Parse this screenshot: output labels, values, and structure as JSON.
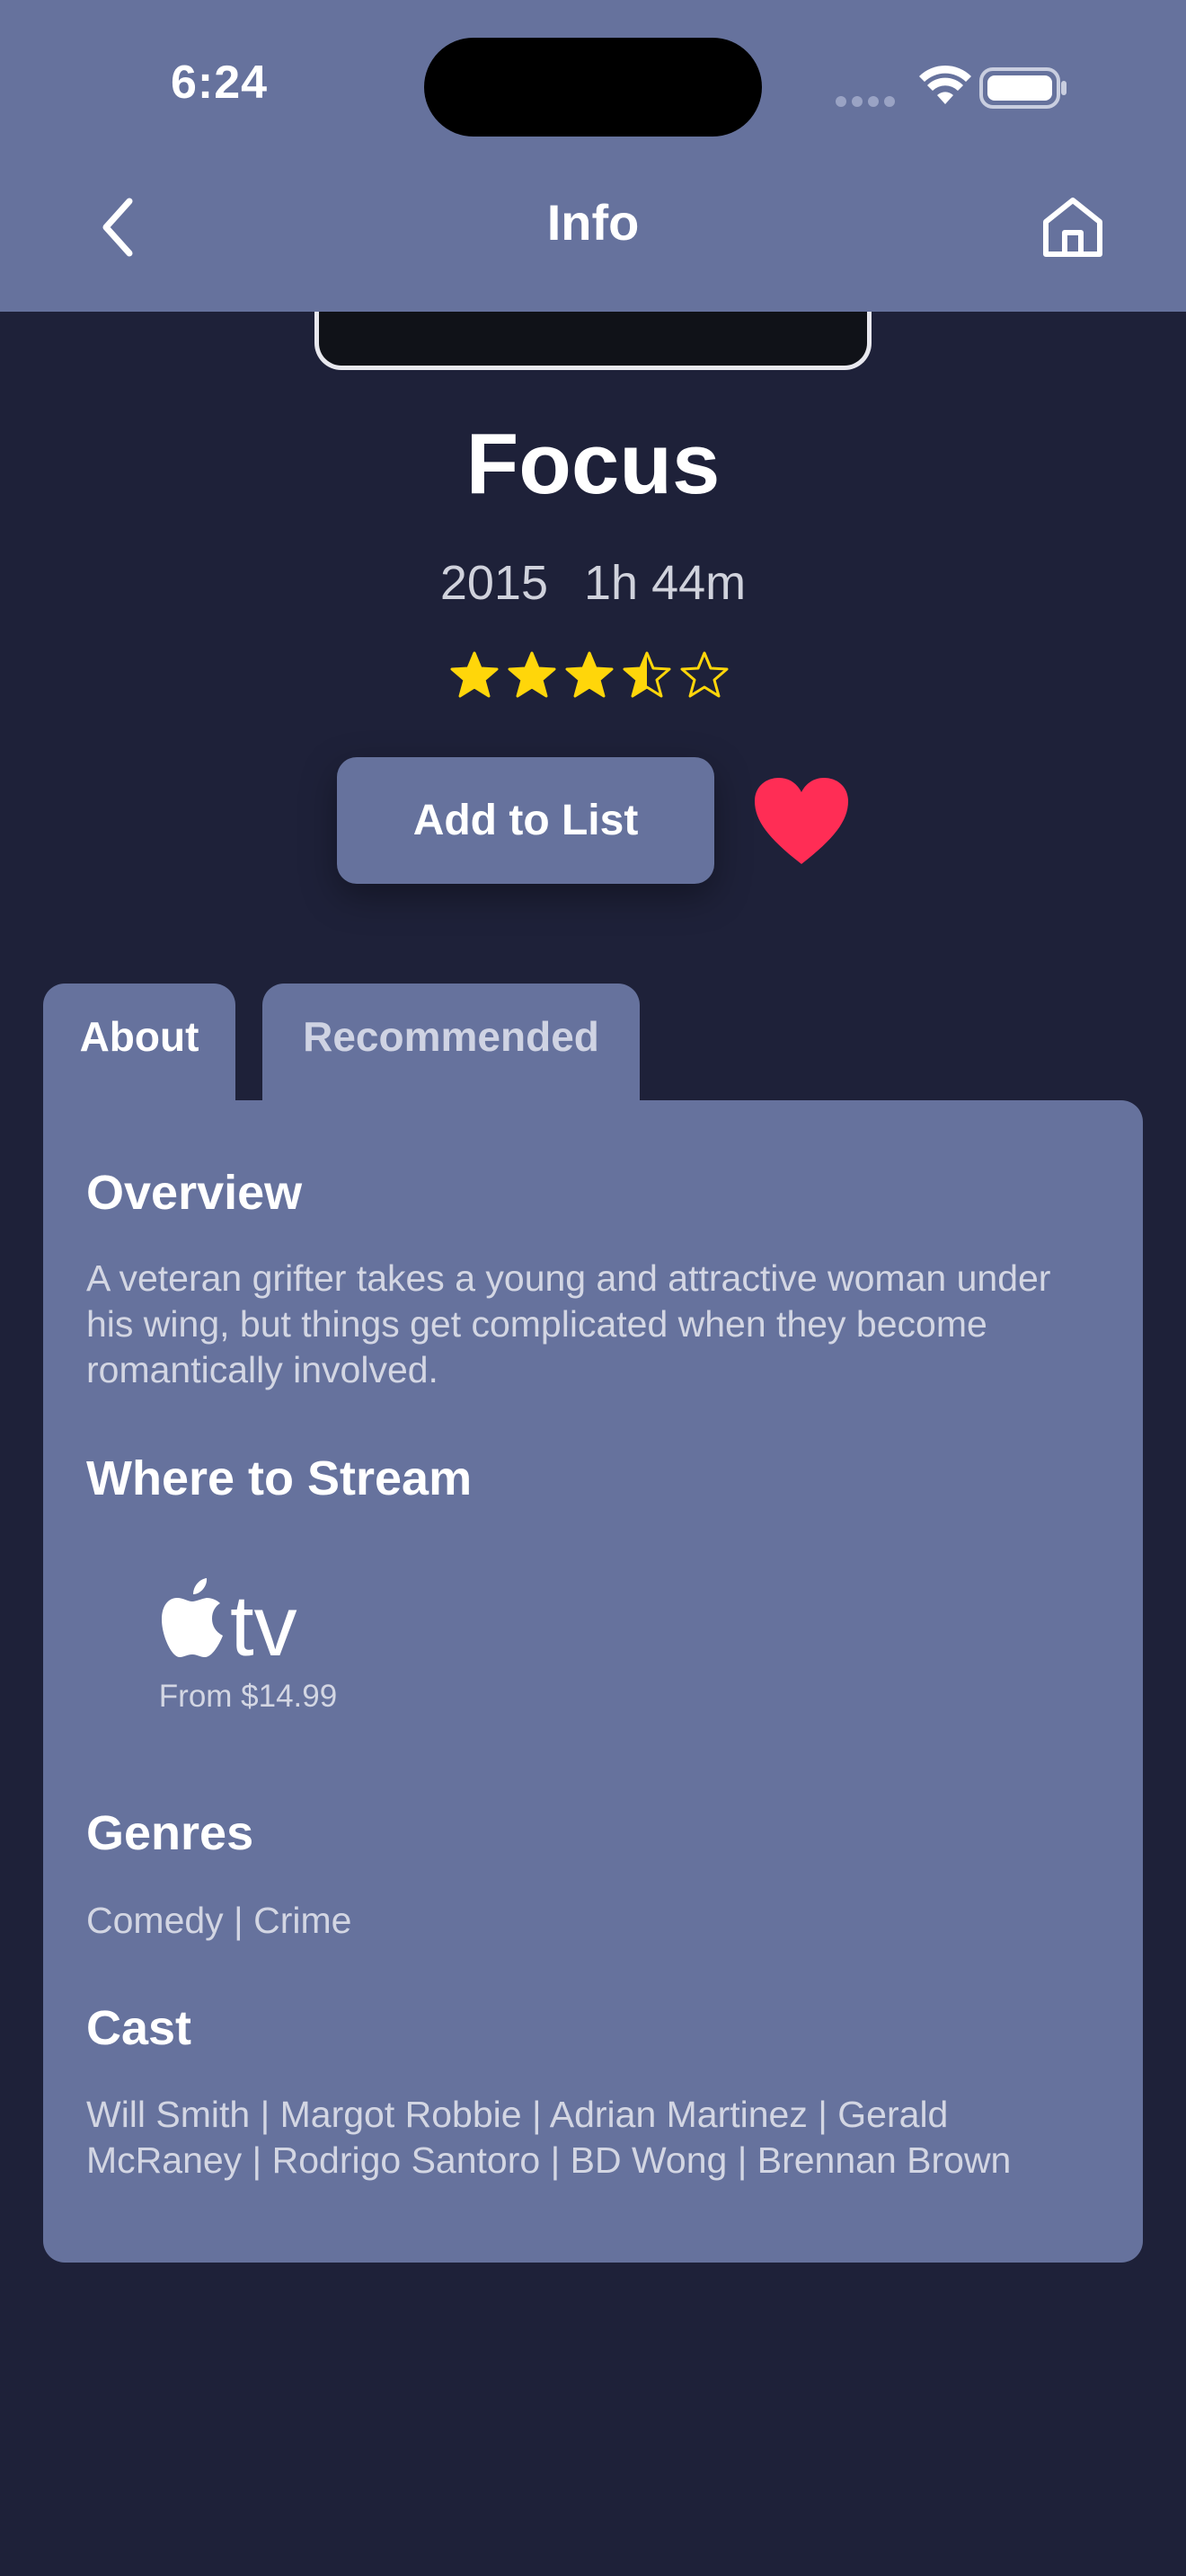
{
  "status_bar": {
    "time": "6:24"
  },
  "nav": {
    "title": "Info",
    "back_icon": "chevron-left-icon",
    "home_icon": "home-icon"
  },
  "movie": {
    "title": "Focus",
    "year": "2015",
    "runtime": "1h 44m",
    "rating_stars": 3.5,
    "rating_max": 5,
    "star_color": "#FFD60A"
  },
  "actions": {
    "add_to_list": "Add to List",
    "favorite_icon": "heart-icon",
    "favorite_color": "#FF2D55"
  },
  "tabs": [
    {
      "label": "About",
      "selected": true
    },
    {
      "label": "Recommended",
      "selected": false
    }
  ],
  "about": {
    "overview_heading": "Overview",
    "overview_text": "A veteran grifter takes a young and attractive woman under his wing, but things get complicated when they become romantically involved.",
    "stream_heading": "Where to Stream",
    "stream": {
      "provider": "Apple TV",
      "provider_icon": "apple-tv-logo",
      "price": "From $14.99"
    },
    "genres_heading": "Genres",
    "genres": "Comedy | Crime",
    "cast_heading": "Cast",
    "cast": "Will Smith | Margot Robbie | Adrian Martinez | Gerald McRaney | Rodrigo Santoro | BD Wong | Brennan Brown"
  },
  "colors": {
    "background": "#1E2139",
    "accent": "#66729D"
  }
}
